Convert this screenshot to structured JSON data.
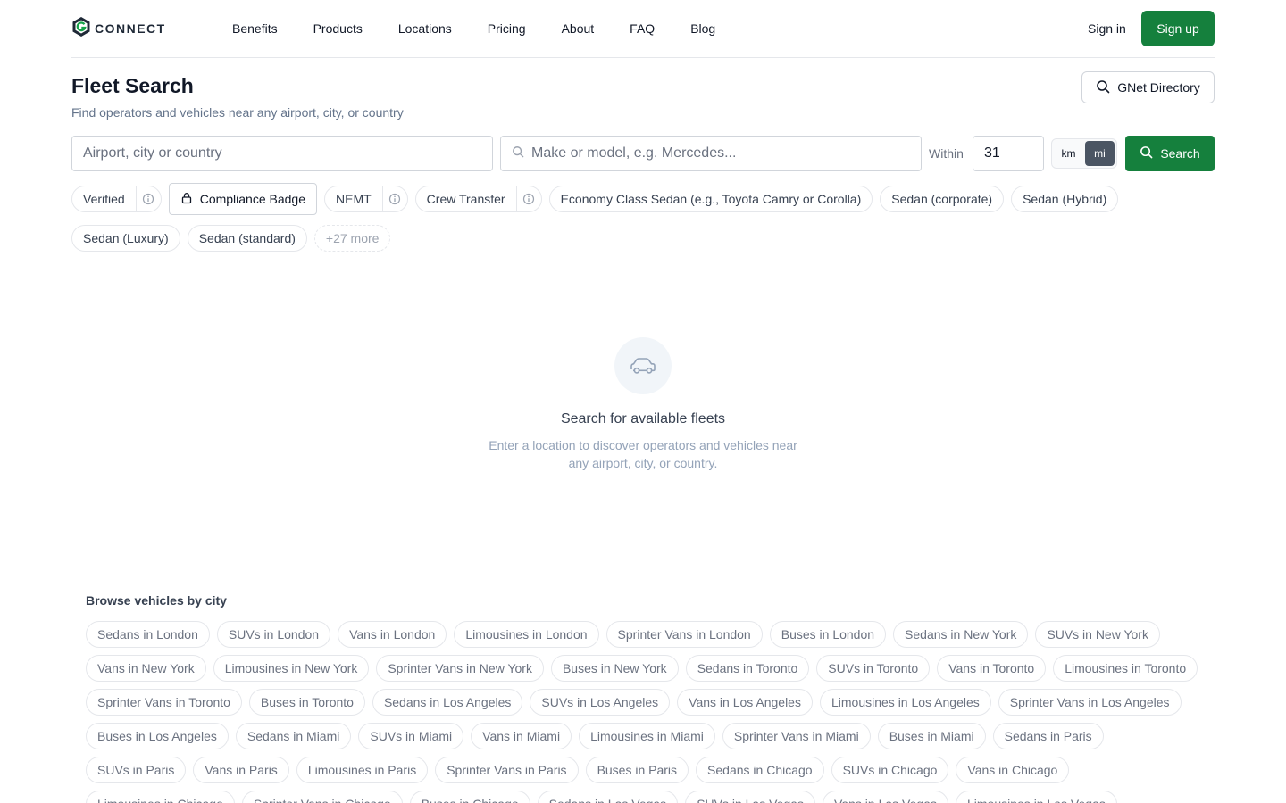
{
  "header": {
    "logo_text": "CONNECT",
    "nav": [
      "Benefits",
      "Products",
      "Locations",
      "Pricing",
      "About",
      "FAQ",
      "Blog"
    ],
    "sign_in": "Sign in",
    "sign_up": "Sign up"
  },
  "page": {
    "title": "Fleet Search",
    "subtitle": "Find operators and vehicles near any airport, city, or country",
    "directory_button": "GNet Directory"
  },
  "search": {
    "location_placeholder": "Airport, city or country",
    "model_placeholder": "Make or model, e.g. Mercedes...",
    "within_label": "Within",
    "radius_value": "31",
    "unit_km": "km",
    "unit_mi": "mi",
    "active_unit": "mi",
    "search_button": "Search"
  },
  "filters": {
    "verified": "Verified",
    "compliance_badge": "Compliance Badge",
    "nemt": "NEMT",
    "crew_transfer": "Crew Transfer",
    "vehicle_types_row1": [
      "Economy Class Sedan (e.g., Toyota Camry or Corolla)",
      "Sedan (corporate)",
      "Sedan (Hybrid)"
    ],
    "vehicle_types_row2": [
      "Sedan (Luxury)",
      "Sedan (standard)"
    ],
    "more": "+27 more"
  },
  "empty_state": {
    "title": "Search for available fleets",
    "desc_line1": "Enter a location to discover operators and vehicles near",
    "desc_line2": "any airport, city, or country."
  },
  "browse": {
    "title": "Browse vehicles by city",
    "links": [
      "Sedans in London",
      "SUVs in London",
      "Vans in London",
      "Limousines in London",
      "Sprinter Vans in London",
      "Buses in London",
      "Sedans in New York",
      "SUVs in New York",
      "Vans in New York",
      "Limousines in New York",
      "Sprinter Vans in New York",
      "Buses in New York",
      "Sedans in Toronto",
      "SUVs in Toronto",
      "Vans in Toronto",
      "Limousines in Toronto",
      "Sprinter Vans in Toronto",
      "Buses in Toronto",
      "Sedans in Los Angeles",
      "SUVs in Los Angeles",
      "Vans in Los Angeles",
      "Limousines in Los Angeles",
      "Sprinter Vans in Los Angeles",
      "Buses in Los Angeles",
      "Sedans in Miami",
      "SUVs in Miami",
      "Vans in Miami",
      "Limousines in Miami",
      "Sprinter Vans in Miami",
      "Buses in Miami",
      "Sedans in Paris",
      "SUVs in Paris",
      "Vans in Paris",
      "Limousines in Paris",
      "Sprinter Vans in Paris",
      "Buses in Paris",
      "Sedans in Chicago",
      "SUVs in Chicago",
      "Vans in Chicago",
      "Limousines in Chicago",
      "Sprinter Vans in Chicago",
      "Buses in Chicago",
      "Sedans in Las Vegas",
      "SUVs in Las Vegas",
      "Vans in Las Vegas",
      "Limousines in Las Vegas"
    ]
  },
  "colors": {
    "brand_green": "#15803d",
    "text_primary": "#111827",
    "text_muted": "#6b7280",
    "border": "#e5e7eb",
    "active_toggle": "#4b5563"
  },
  "icons": {
    "logo": "g-hexagon-logo-icon",
    "directory": "search-icon",
    "model_search": "search-icon",
    "search_button": "search-icon",
    "info": "info-icon",
    "lock": "lock-icon",
    "empty_state": "car-icon"
  }
}
